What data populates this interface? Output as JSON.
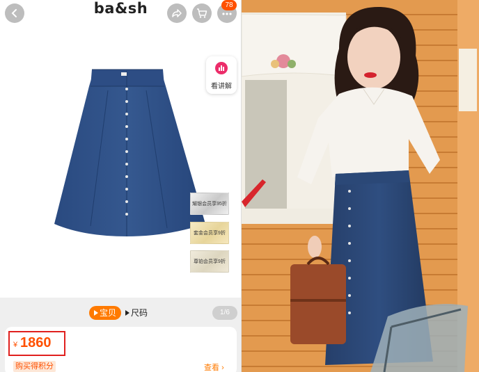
{
  "header": {
    "brand": "ba&sh",
    "cart_badge": "78",
    "icons": [
      "chevron-left-icon",
      "share-icon",
      "cart-icon",
      "more-icon"
    ]
  },
  "explain": {
    "label": "看讲解",
    "icon": "chart-icon"
  },
  "member_tags": [
    "耀银会员享95折",
    "套金会员享9折",
    "尊铂会员享9折"
  ],
  "tabs": {
    "active": "宝贝",
    "second": "尺码",
    "page_indicator": "1/6"
  },
  "price": {
    "currency": "¥",
    "value": "1860",
    "points_label": "购买得积分",
    "view_link": "查看"
  },
  "colors": {
    "accent": "#ff5000",
    "tab_active": "#ff7a00",
    "highlight_box": "#e0201e"
  }
}
